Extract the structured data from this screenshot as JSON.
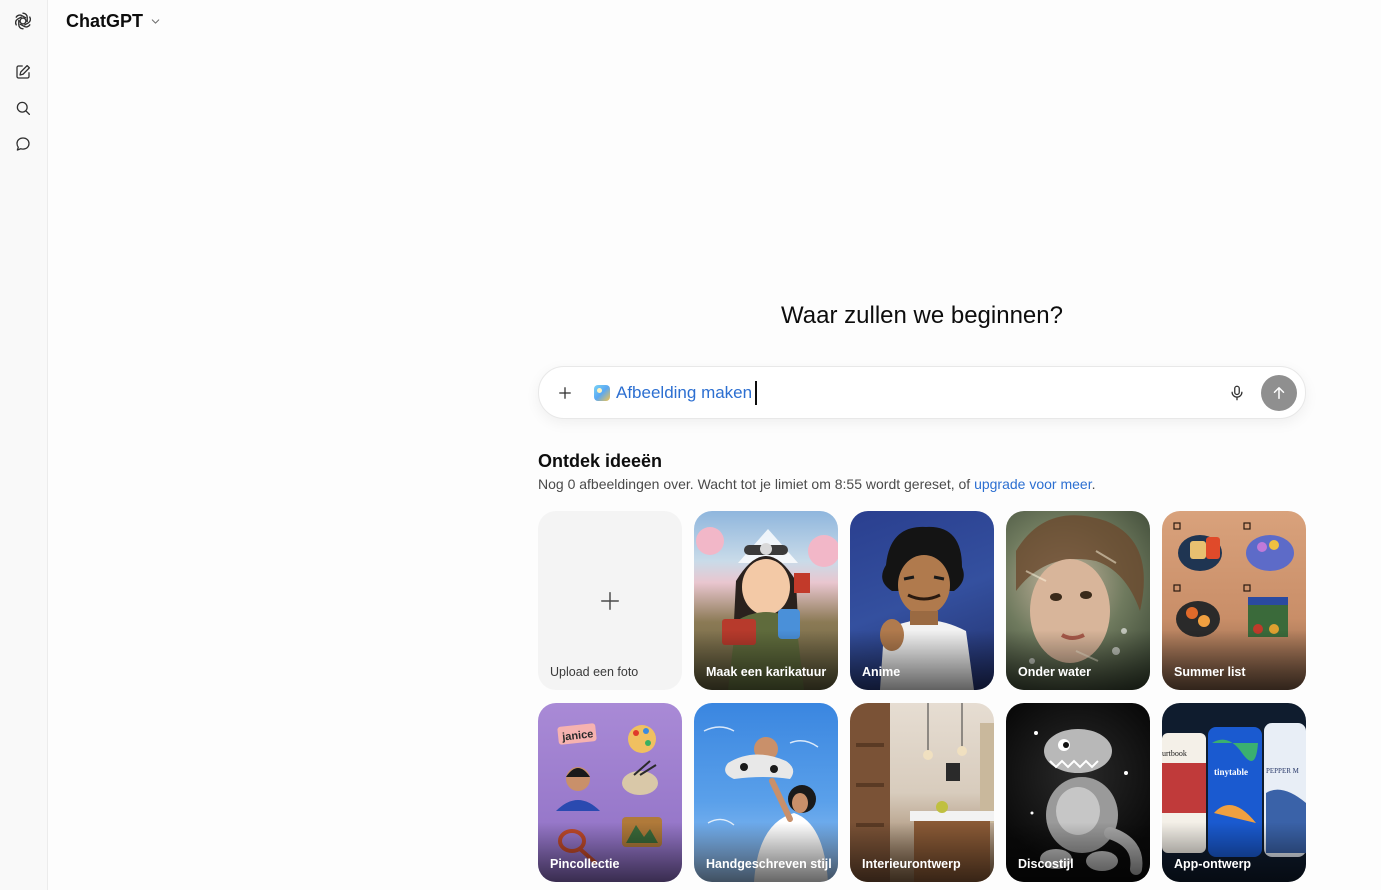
{
  "app": {
    "model_name": "ChatGPT"
  },
  "rail": {
    "items": [
      {
        "icon": "openai-logo-icon"
      },
      {
        "icon": "new-chat-icon"
      },
      {
        "icon": "search-icon"
      },
      {
        "icon": "chat-bubble-icon"
      }
    ]
  },
  "main": {
    "heading": "Waar zullen we beginnen?",
    "composer": {
      "tool_chip_label": "Afbeelding maken",
      "input_value": "",
      "input_placeholder": ""
    },
    "discover": {
      "title": "Ontdek ideeën",
      "subtitle_prefix": "Nog 0 afbeeldingen over. Wacht tot je limiet om 8:55 wordt gereset, of ",
      "subtitle_link": "upgrade voor meer",
      "subtitle_suffix": "."
    },
    "cards": [
      {
        "label": "Upload een foto"
      },
      {
        "label": "Maak een karikatuur"
      },
      {
        "label": "Anime"
      },
      {
        "label": "Onder water"
      },
      {
        "label": "Summer list"
      },
      {
        "label": "Pincollectie"
      },
      {
        "label": "Handgeschreven stijl"
      },
      {
        "label": "Interieurontwerp"
      },
      {
        "label": "Discostijl"
      },
      {
        "label": "App-ontwerp"
      }
    ],
    "card_art_text": {
      "pin_name_tag": "janice",
      "app_brand_1": "tinytable",
      "app_brand_2": "PEPPER M",
      "app_brand_3": "urtbook"
    }
  },
  "colors": {
    "accent_link": "#2c6fd1",
    "send_disabled": "#8f8f8f",
    "rail_bg": "#f9f9f9"
  }
}
